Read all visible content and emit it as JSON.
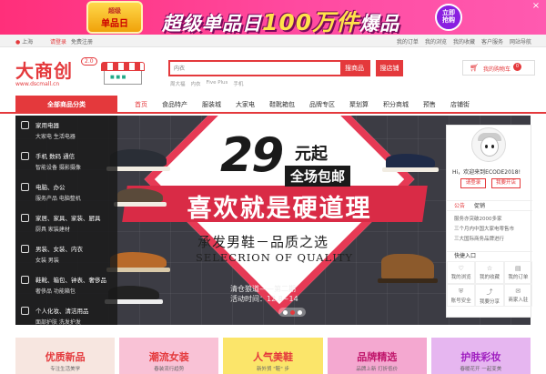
{
  "promo": {
    "badge_top": "超级",
    "badge_mid": "单品日",
    "badge_bottom": "",
    "title_prefix": "超级单品日",
    "title_highlight": "100万件",
    "title_suffix": "爆品",
    "cta_line1": "立即",
    "cta_line2": "抢购",
    "close": "×"
  },
  "topbar": {
    "location": "上海",
    "login": "请登录",
    "register": "免费注册",
    "links": [
      "我的订单",
      "我的浏览",
      "我的收藏",
      "客户服务",
      "网站导航"
    ]
  },
  "header": {
    "logo": "大商创",
    "logo_version": "2.0",
    "logo_url": "www.dscmall.cn",
    "search_placeholder": "内衣",
    "search_goods_btn": "搜商品",
    "search_store_btn": "搜店铺",
    "hotwords": [
      "周大福",
      "内衣",
      "Five Plus",
      "手机"
    ],
    "cart_label": "我的购物车",
    "cart_count": "0"
  },
  "nav": {
    "all_categories": "全部商品分类",
    "items": [
      "首页",
      "食品特产",
      "服装城",
      "大家电",
      "鞋靴箱包",
      "品牌专区",
      "聚划算",
      "积分商城",
      "预售",
      "店铺街"
    ]
  },
  "categories": [
    {
      "title": "家用电器",
      "sub": "大家电 生活电器"
    },
    {
      "title": "手机 数码 通信",
      "sub": "智能设备 摄影摄像"
    },
    {
      "title": "电脑、办公",
      "sub": "服务产品 电脑整机"
    },
    {
      "title": "家居、家具、家装、厨具",
      "sub": "厨具 家装建材"
    },
    {
      "title": "男装、女装、内衣",
      "sub": "女装 男装"
    },
    {
      "title": "鞋靴、箱包、钟表、奢侈品",
      "sub": "奢侈品 功能箱包"
    },
    {
      "title": "个人化妆、清洁用品",
      "sub": "面部护肤 洗发护发"
    }
  ],
  "hero": {
    "price": "29",
    "price_suffix": "元起",
    "shipping": "全场包邮",
    "slogan": "喜欢就是硬道理",
    "subtitle": "承发男鞋－品质之选",
    "english": "SELECRION OF QUALITY",
    "clearance_line1": "清仓狼道——第二期",
    "clearance_line2": "活动时间：12.8~14"
  },
  "user_panel": {
    "greeting": "Hi，欢迎来到ECODE2018!",
    "login_btn": "请登录",
    "open_store_btn": "我要开店",
    "tabs": [
      "公告",
      "促销"
    ],
    "news": [
      "服务亦突破2000多家",
      "三个月内中国大家电零售市",
      "三大国际商务品牌进行"
    ],
    "quick_title": "快捷入口",
    "quick_links": [
      {
        "icon": "♡",
        "label": "我的浏览"
      },
      {
        "icon": "☆",
        "label": "我的收藏"
      },
      {
        "icon": "▤",
        "label": "我的订单"
      },
      {
        "icon": "⛨",
        "label": "账号安全"
      },
      {
        "icon": "⤴",
        "label": "我要分享"
      },
      {
        "icon": "✉",
        "label": "商家入驻"
      }
    ]
  },
  "cards": [
    {
      "title": "优质新品",
      "sub": "专注生活美学",
      "bg": "#f7e6e0",
      "color": "#e4393c"
    },
    {
      "title": "潮流女装",
      "sub": "春装流行趋势",
      "bg": "#f9c2d6",
      "color": "#e4393c"
    },
    {
      "title": "人气美鞋",
      "sub": "新外贸 \"鞋\" 步",
      "bg": "#fbe56a",
      "color": "#e4393c"
    },
    {
      "title": "品牌精选",
      "sub": "品牌上新 打折低价",
      "bg": "#f4a8d0",
      "color": "#c0166b"
    },
    {
      "title": "护肤彩妆",
      "sub": "春暖花开 一起变美",
      "bg": "#e6b6f0",
      "color": "#a020c0"
    }
  ],
  "colors": {
    "brand": "#e4393c"
  }
}
